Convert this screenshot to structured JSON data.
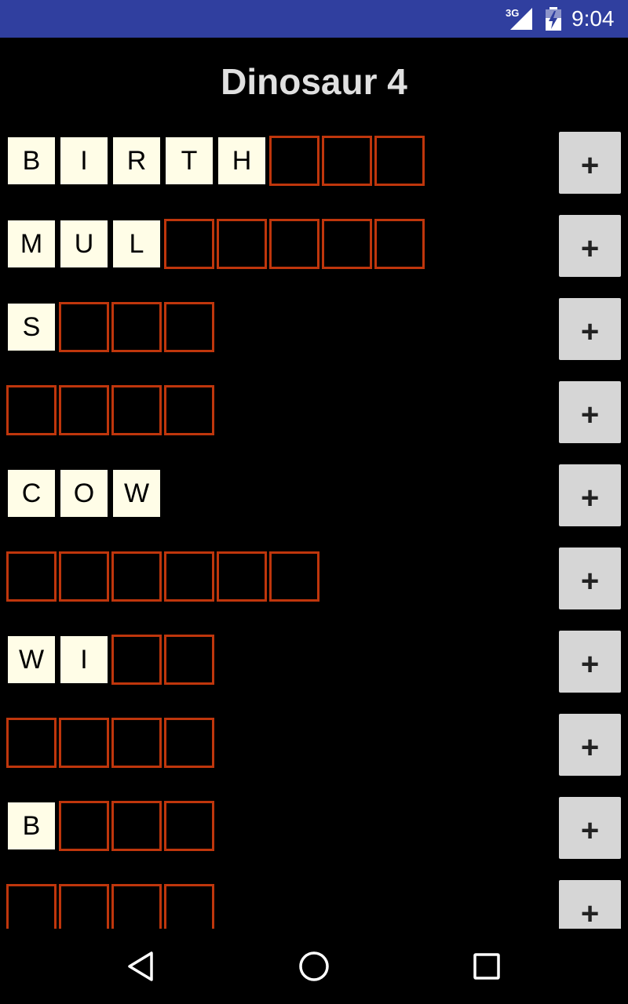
{
  "status_bar": {
    "network": "3G",
    "time": "9:04",
    "icons": [
      "signal-icon",
      "battery-charging-icon"
    ]
  },
  "title": "Dinosaur 4",
  "add_button_label": "+",
  "rows": [
    {
      "tiles": [
        "B",
        "I",
        "R",
        "T",
        "H",
        "",
        "",
        ""
      ]
    },
    {
      "tiles": [
        "M",
        "U",
        "L",
        "",
        "",
        "",
        "",
        ""
      ]
    },
    {
      "tiles": [
        "S",
        "",
        "",
        ""
      ]
    },
    {
      "tiles": [
        "",
        "",
        "",
        ""
      ]
    },
    {
      "tiles": [
        "C",
        "O",
        "W"
      ]
    },
    {
      "tiles": [
        "",
        "",
        "",
        "",
        "",
        ""
      ]
    },
    {
      "tiles": [
        "W",
        "I",
        "",
        ""
      ]
    },
    {
      "tiles": [
        "",
        "",
        "",
        ""
      ]
    },
    {
      "tiles": [
        "B",
        "",
        "",
        ""
      ]
    },
    {
      "tiles": [
        "",
        "",
        "",
        ""
      ]
    }
  ],
  "nav_bar": {
    "icons": [
      "back-icon",
      "home-icon",
      "recents-icon"
    ]
  },
  "colors": {
    "status_bar": "#303f9f",
    "background": "#000000",
    "filled_tile": "#fffde7",
    "empty_tile_border": "#bf360c",
    "add_button": "#d6d6d6",
    "title": "#e0e0e0"
  }
}
